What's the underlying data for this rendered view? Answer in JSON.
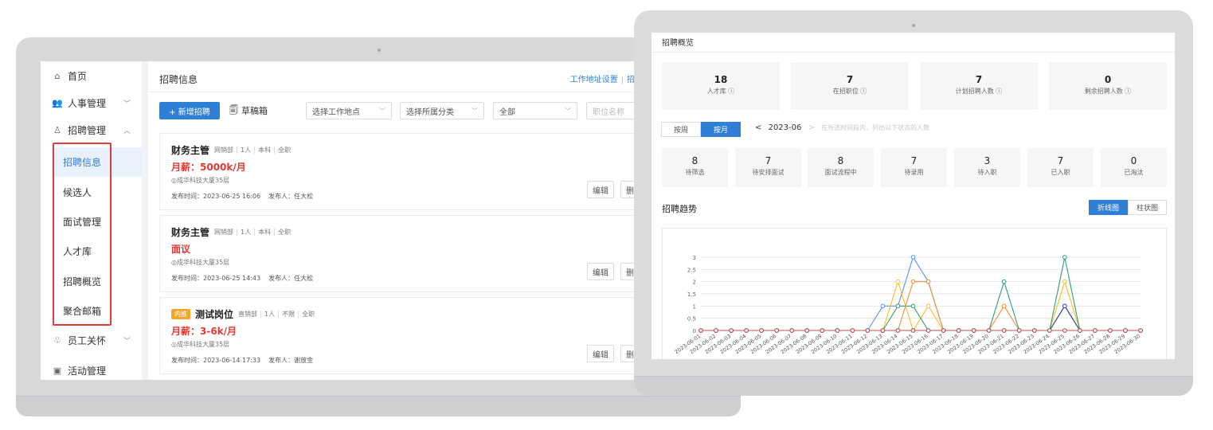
{
  "left": {
    "sidebar": {
      "items": [
        {
          "label": "首页",
          "icon": "home-icon",
          "chevron": ""
        },
        {
          "label": "人事管理",
          "icon": "users-icon",
          "chevron": "⌄"
        },
        {
          "label": "招聘管理",
          "icon": "recruit-icon",
          "chevron": "⌃"
        }
      ],
      "sub_items": [
        "招聘信息",
        "候选人",
        "面试管理",
        "人才库",
        "招聘概览",
        "聚合邮箱"
      ],
      "bottom_items": [
        {
          "label": "员工关怀",
          "icon": "care-icon",
          "chevron": "⌄"
        },
        {
          "label": "活动管理",
          "icon": "activity-icon",
          "chevron": ""
        }
      ]
    },
    "main": {
      "title": "招聘信息",
      "links": [
        "工作地址设置",
        "招聘职位"
      ],
      "new_button": "+ 新增招聘",
      "draft_button": "草稿箱",
      "filters": {
        "location": "选择工作地点",
        "category": "选择所属分类",
        "status": "全部",
        "keyword_placeholder": "职位名称"
      },
      "jobs": [
        {
          "tag": "",
          "title": "财务主管",
          "dept": "网销部",
          "count": "1人",
          "edu": "本科",
          "type": "全职",
          "salary": "月薪：5000k/月",
          "address": "◎成华科技大厦35层",
          "publish": "发布时间：2023-06-25 16:06",
          "publisher": "发布人：任大松"
        },
        {
          "tag": "",
          "title": "财务主管",
          "dept": "网销部",
          "count": "1人",
          "edu": "本科",
          "type": "全职",
          "salary": "面议",
          "address": "◎成华科技大厦35层",
          "publish": "发布时间：2023-06-25 14:43",
          "publisher": "发布人：任大松"
        },
        {
          "tag": "内推",
          "title": "测试岗位",
          "dept": "直销部",
          "count": "1人",
          "edu": "不限",
          "type": "全职",
          "salary": "月薪：3-6k/月",
          "address": "◎成华科技大厦35层",
          "publish": "发布时间：2023-06-14 17:33",
          "publisher": "发布人：谢放金"
        }
      ],
      "edit_label": "编辑",
      "delete_label": "删除"
    }
  },
  "right": {
    "title": "招聘概览",
    "stats": [
      {
        "num": "18",
        "label": "人才库 ⓘ"
      },
      {
        "num": "7",
        "label": "在招职位 ⓘ"
      },
      {
        "num": "7",
        "label": "计划招聘人数 ⓘ"
      },
      {
        "num": "0",
        "label": "剩余招聘人数 ⓘ"
      }
    ],
    "tabs": [
      "按周",
      "按月"
    ],
    "month": "2023-06",
    "prev": "<",
    "next": ">",
    "hint": "在所选时间段内，列出以下状态的人数",
    "pipeline": [
      {
        "num": "8",
        "label": "待筛选"
      },
      {
        "num": "7",
        "label": "待安排面试"
      },
      {
        "num": "8",
        "label": "面试流程中"
      },
      {
        "num": "7",
        "label": "待录用"
      },
      {
        "num": "3",
        "label": "待入职"
      },
      {
        "num": "7",
        "label": "已入职"
      },
      {
        "num": "0",
        "label": "已淘汰"
      }
    ],
    "trend_title": "招聘趋势",
    "chart_tabs": [
      "折线图",
      "柱状图"
    ]
  },
  "chart_data": {
    "type": "line",
    "title": "招聘趋势",
    "xlabel": "",
    "ylabel": "",
    "ylim": [
      0,
      3
    ],
    "yticks": [
      "0",
      "0.5",
      "1",
      "1.5",
      "2",
      "2.5",
      "3"
    ],
    "x": [
      "2023-06-01",
      "2023-06-02",
      "2023-06-03",
      "2023-06-04",
      "2023-06-05",
      "2023-06-06",
      "2023-06-07",
      "2023-06-08",
      "2023-06-09",
      "2023-06-10",
      "2023-06-11",
      "2023-06-12",
      "2023-06-13",
      "2023-06-14",
      "2023-06-15",
      "2023-06-16",
      "2023-06-17",
      "2023-06-18",
      "2023-06-19",
      "2023-06-20",
      "2023-06-21",
      "2023-06-22",
      "2023-06-23",
      "2023-06-24",
      "2023-06-25",
      "2023-06-26",
      "2023-06-27",
      "2023-06-28",
      "2023-06-29",
      "2023-06-30"
    ],
    "grid": true,
    "series": [
      {
        "color": "#5b8ff9",
        "values": [
          0,
          0,
          0,
          0,
          0,
          0,
          0,
          0,
          0,
          0,
          0,
          0,
          1,
          1,
          3,
          2,
          0,
          0,
          0,
          0,
          0,
          0,
          0,
          0,
          0,
          0,
          0,
          0,
          0,
          0
        ]
      },
      {
        "color": "#f6c022",
        "values": [
          0,
          0,
          0,
          0,
          0,
          0,
          0,
          0,
          0,
          0,
          0,
          0,
          0,
          2,
          0,
          1,
          0,
          0,
          0,
          0,
          0,
          0,
          0,
          0,
          2,
          0,
          0,
          0,
          0,
          0
        ]
      },
      {
        "color": "#2f9e6e",
        "values": [
          0,
          0,
          0,
          0,
          0,
          0,
          0,
          0,
          0,
          0,
          0,
          0,
          0,
          1,
          1,
          0,
          0,
          0,
          0,
          0,
          2,
          0,
          0,
          0,
          3,
          0,
          0,
          0,
          0,
          0
        ]
      },
      {
        "color": "#f08c3c",
        "values": [
          0,
          0,
          0,
          0,
          0,
          0,
          0,
          0,
          0,
          0,
          0,
          0,
          0,
          0,
          2,
          2,
          0,
          0,
          0,
          0,
          1,
          0,
          0,
          0,
          1,
          0,
          0,
          0,
          0,
          0
        ]
      },
      {
        "color": "#2b3aa8",
        "values": [
          0,
          0,
          0,
          0,
          0,
          0,
          0,
          0,
          0,
          0,
          0,
          0,
          0,
          0,
          0,
          0,
          0,
          0,
          0,
          0,
          0,
          0,
          0,
          0,
          1,
          0,
          0,
          0,
          0,
          0
        ]
      },
      {
        "color": "#c0504d",
        "values": [
          0,
          0,
          0,
          0,
          0,
          0,
          0,
          0,
          0,
          0,
          0,
          0,
          0,
          0,
          0,
          0,
          0,
          0,
          0,
          0,
          0,
          0,
          0,
          0,
          0,
          0,
          0,
          0,
          0,
          0
        ]
      }
    ]
  }
}
